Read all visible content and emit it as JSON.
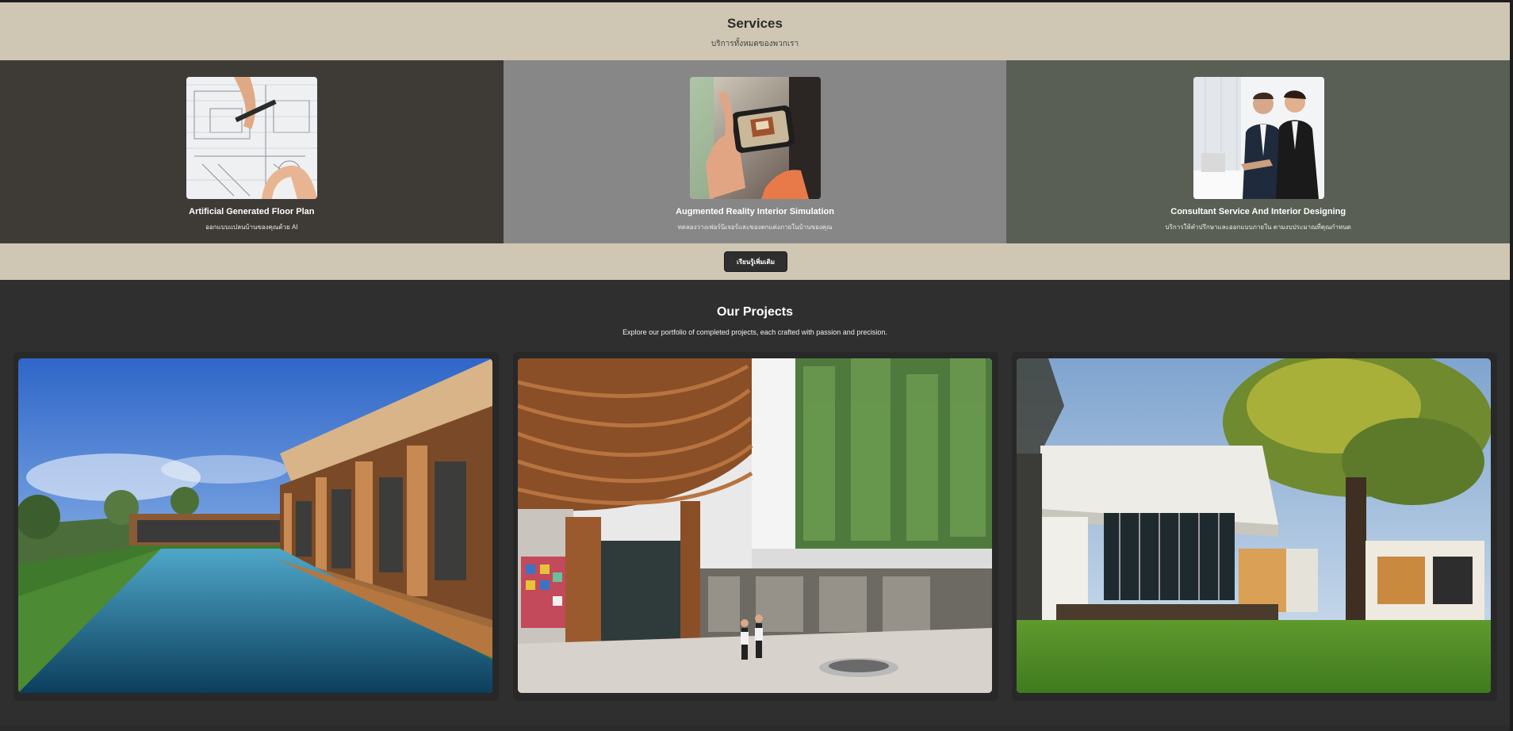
{
  "services": {
    "title": "Services",
    "subtitle": "บริการทั้งหมดของพวกเรา",
    "cards": [
      {
        "title": "Artificial Generated Floor Plan",
        "description": "ออกแบบแปลนบ้านของคุณด้วย AI",
        "background": "#3e3b37",
        "image_icon": "floor-plan-drawing-icon"
      },
      {
        "title": "Augmented Reality Interior Simulation",
        "description": "ทดลองวางเฟอร์นิเจอร์และของตกแต่งภายในบ้านของคุณ",
        "background": "#878787",
        "image_icon": "ar-phone-icon"
      },
      {
        "title": "Consultant Service And Interior Designing",
        "description": "บริการให้คำปรึกษาและออกแบบภายใน ตามงบประมาณที่คุณกำหนด",
        "background": "#5a5f55",
        "image_icon": "consultants-meeting-icon"
      }
    ],
    "button_label": "เรียนรู้เพิ่มเติม",
    "band_color": "#cfc7b3"
  },
  "projects": {
    "title": "Our Projects",
    "subtitle": "Explore our portfolio of completed projects, each crafted with passion and precision.",
    "items": [
      {
        "image_icon": "pool-villa-photo"
      },
      {
        "image_icon": "wooden-atrium-building-photo"
      },
      {
        "image_icon": "modern-house-garden-photo"
      }
    ]
  }
}
